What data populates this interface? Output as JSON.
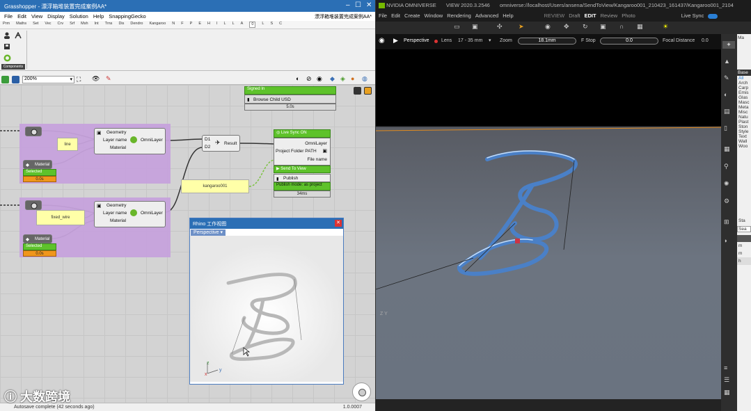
{
  "grasshopper": {
    "title": "Grasshopper - 漂浮箱堆装置完成案例AA*",
    "doc_title_right": "漂浮箱堆装置完成案例AA*",
    "menu": [
      "File",
      "Edit",
      "View",
      "Display",
      "Solution",
      "Help",
      "SnappingGecko"
    ],
    "tabs": [
      "Prm",
      "Maths",
      "Set",
      "Vec",
      "Crv",
      "Srf",
      "Msh",
      "Int",
      "Trns",
      "Dis",
      "Dendro",
      "Kangaroo",
      "N",
      "F",
      "P",
      "E",
      "H",
      "I",
      "L",
      "L",
      "A",
      "0",
      "L",
      "S",
      "C"
    ],
    "ribbon_label": "Components",
    "zoom": "200%",
    "status": "Autosave complete (42 seconds ago)",
    "version": "1.0.0007",
    "components": {
      "geometry1": {
        "title": "Geometry",
        "in1": "Layer name",
        "in2": "Material",
        "out": "OmniLayer"
      },
      "geometry2": {
        "title": "Geometry",
        "in1": "Layer name",
        "in2": "Material",
        "out": "OmniLayer"
      },
      "panel_line": "line",
      "panel_fixed": "fixed_wire",
      "panel_kangaroo": "kangaroo001",
      "material1": "Material",
      "material2": "Material",
      "selected1": "Selected",
      "selected2": "Selected",
      "time1": "0.0s",
      "time2": "0.0s",
      "merge": {
        "d1": "D1",
        "d2": "D2",
        "out": "Result"
      },
      "signed_in": "Signed In",
      "browse": "Browse Child USD",
      "browse_time": "5.0s",
      "live_sync": {
        "header": "Live Sync ON",
        "in1": "OmniLayer",
        "in2": "Project Folder PATH",
        "in3": "File name",
        "send": "Send To View",
        "publish": "Publish",
        "publish_mode": "Publish mode: as project",
        "time": "34ms"
      }
    }
  },
  "rhino": {
    "title": "Rhino 工作视图",
    "tab": "Perspective",
    "axis_z": "z",
    "axis_y": "y",
    "axis_x": "x"
  },
  "omniverse": {
    "app": "NVIDIA OMNIVERSE",
    "view_version": "VIEW 2020.3.2546",
    "path": "omniverse://localhost/Users/ansena/SendToView/Kangaroo001_210423_161437/Kangaroo001_2104",
    "menu": [
      "File",
      "Edit",
      "Create",
      "Window",
      "Rendering",
      "Advanced",
      "Help"
    ],
    "modes": [
      "REVIEW",
      "Draft",
      "EDIT",
      "Review",
      "Photo"
    ],
    "live_sync": "Live Sync",
    "camera": "Perspective",
    "lens_label": "Lens",
    "lens_value": "17 - 35 mm",
    "zoom_label": "Zoom",
    "zoom_value": "18.1mm",
    "fstop_label": "F Stop",
    "fstop_value": "0.0",
    "focal_label": "Focal Distance",
    "focal_value": "0.0",
    "axis_label": "Z Y",
    "side_panel": {
      "header": "Ma",
      "tab": "Base",
      "items": [
        "All",
        "Arch",
        "Carp",
        "Emis",
        "Glas",
        "Masc",
        "Meta",
        "Misc",
        "Natu",
        "Plast",
        "Ston",
        "Style",
        "Text",
        "Wall",
        "Woo"
      ],
      "lower_header": "Sta",
      "lower_field": "Sea",
      "lower_items": [
        "m",
        "m",
        "h"
      ]
    }
  },
  "watermark": "大数跨境"
}
